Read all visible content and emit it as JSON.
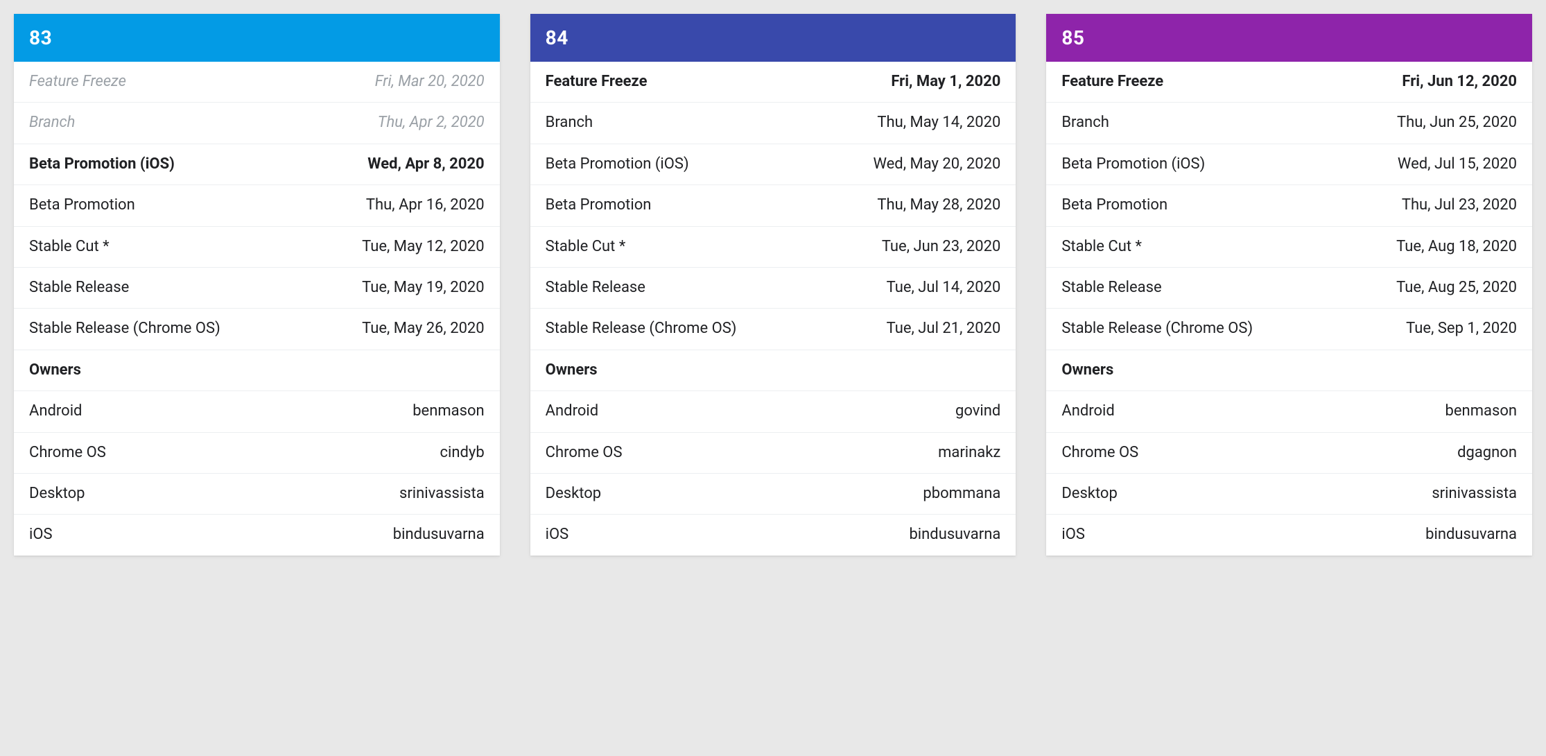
{
  "releases": [
    {
      "version": "83",
      "header_color": "#039be5",
      "milestones": [
        {
          "label": "Feature Freeze",
          "date": "Fri, Mar 20, 2020",
          "style": "muted"
        },
        {
          "label": "Branch",
          "date": "Thu, Apr 2, 2020",
          "style": "muted"
        },
        {
          "label": "Beta Promotion (iOS)",
          "date": "Wed, Apr 8, 2020",
          "style": "bold"
        },
        {
          "label": "Beta Promotion",
          "date": "Thu, Apr 16, 2020",
          "style": "normal"
        },
        {
          "label": "Stable Cut *",
          "date": "Tue, May 12, 2020",
          "style": "normal"
        },
        {
          "label": "Stable Release",
          "date": "Tue, May 19, 2020",
          "style": "normal"
        },
        {
          "label": "Stable Release (Chrome OS)",
          "date": "Tue, May 26, 2020",
          "style": "normal"
        }
      ],
      "owners_label": "Owners",
      "owners": [
        {
          "platform": "Android",
          "name": "benmason"
        },
        {
          "platform": "Chrome OS",
          "name": "cindyb"
        },
        {
          "platform": "Desktop",
          "name": "srinivassista"
        },
        {
          "platform": "iOS",
          "name": "bindusuvarna"
        }
      ]
    },
    {
      "version": "84",
      "header_color": "#3949ab",
      "milestones": [
        {
          "label": "Feature Freeze",
          "date": "Fri, May 1, 2020",
          "style": "bold"
        },
        {
          "label": "Branch",
          "date": "Thu, May 14, 2020",
          "style": "normal"
        },
        {
          "label": "Beta Promotion (iOS)",
          "date": "Wed, May 20, 2020",
          "style": "normal"
        },
        {
          "label": "Beta Promotion",
          "date": "Thu, May 28, 2020",
          "style": "normal"
        },
        {
          "label": "Stable Cut *",
          "date": "Tue, Jun 23, 2020",
          "style": "normal"
        },
        {
          "label": "Stable Release",
          "date": "Tue, Jul 14, 2020",
          "style": "normal"
        },
        {
          "label": "Stable Release (Chrome OS)",
          "date": "Tue, Jul 21, 2020",
          "style": "normal"
        }
      ],
      "owners_label": "Owners",
      "owners": [
        {
          "platform": "Android",
          "name": "govind"
        },
        {
          "platform": "Chrome OS",
          "name": "marinakz"
        },
        {
          "platform": "Desktop",
          "name": "pbommana"
        },
        {
          "platform": "iOS",
          "name": "bindusuvarna"
        }
      ]
    },
    {
      "version": "85",
      "header_color": "#8e24aa",
      "milestones": [
        {
          "label": "Feature Freeze",
          "date": "Fri, Jun 12, 2020",
          "style": "bold"
        },
        {
          "label": "Branch",
          "date": "Thu, Jun 25, 2020",
          "style": "normal"
        },
        {
          "label": "Beta Promotion (iOS)",
          "date": "Wed, Jul 15, 2020",
          "style": "normal"
        },
        {
          "label": "Beta Promotion",
          "date": "Thu, Jul 23, 2020",
          "style": "normal"
        },
        {
          "label": "Stable Cut *",
          "date": "Tue, Aug 18, 2020",
          "style": "normal"
        },
        {
          "label": "Stable Release",
          "date": "Tue, Aug 25, 2020",
          "style": "normal"
        },
        {
          "label": "Stable Release (Chrome OS)",
          "date": "Tue, Sep 1, 2020",
          "style": "normal"
        }
      ],
      "owners_label": "Owners",
      "owners": [
        {
          "platform": "Android",
          "name": "benmason"
        },
        {
          "platform": "Chrome OS",
          "name": "dgagnon"
        },
        {
          "platform": "Desktop",
          "name": "srinivassista"
        },
        {
          "platform": "iOS",
          "name": "bindusuvarna"
        }
      ]
    }
  ]
}
